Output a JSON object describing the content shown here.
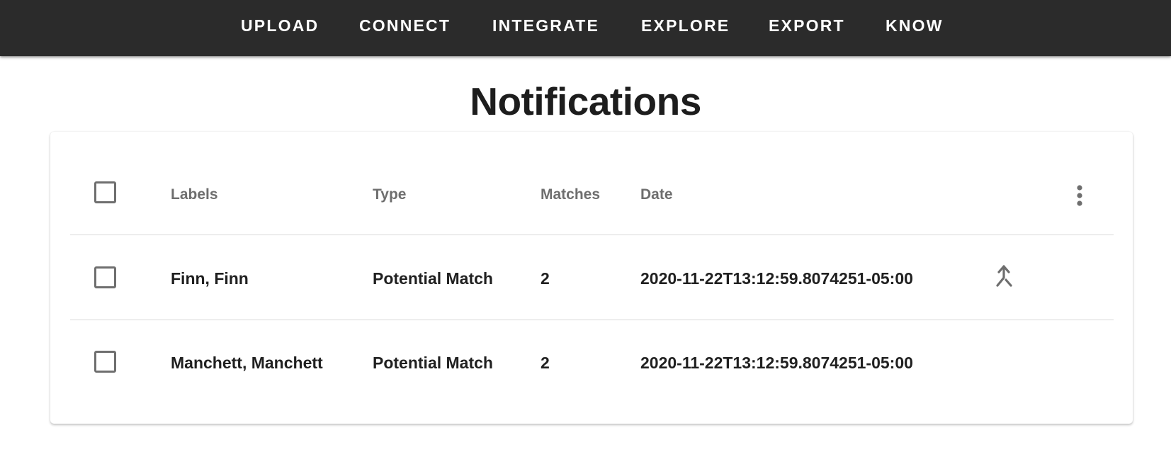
{
  "nav": {
    "items": [
      "UPLOAD",
      "CONNECT",
      "INTEGRATE",
      "EXPLORE",
      "EXPORT",
      "KNOW"
    ],
    "background": "#2b2b2b"
  },
  "page": {
    "title": "Notifications"
  },
  "table": {
    "headers": {
      "labels": "Labels",
      "type": "Type",
      "matches": "Matches",
      "date": "Date"
    },
    "header_actions_icon": "more-vert-icon",
    "rows": [
      {
        "labels": "Finn, Finn",
        "type": "Potential Match",
        "matches": "2",
        "date": "2020-11-22T13:12:59.8074251-05:00",
        "action_icon": "merge-icon"
      },
      {
        "labels": "Manchett, Manchett",
        "type": "Potential Match",
        "matches": "2",
        "date": "2020-11-22T13:12:59.8074251-05:00"
      }
    ]
  }
}
